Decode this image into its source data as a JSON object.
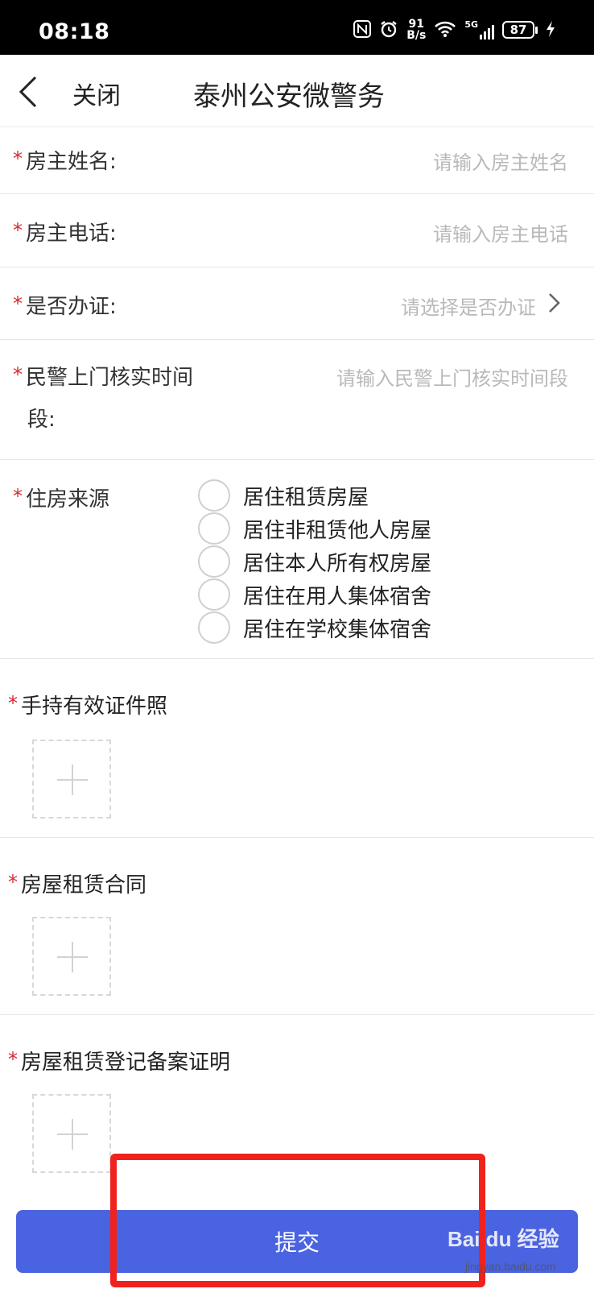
{
  "status_bar": {
    "time": "08:18",
    "net_speed_value": "91",
    "net_speed_unit": "B/s",
    "signal": "5G",
    "battery": "87"
  },
  "nav": {
    "close_label": "关闭",
    "title": "泰州公安微警务"
  },
  "form": {
    "required_mark": "*",
    "owner_name": {
      "label": "房主姓名:",
      "placeholder": "请输入房主姓名"
    },
    "owner_phone": {
      "label": "房主电话:",
      "placeholder": "请输入房主电话"
    },
    "certified": {
      "label": "是否办证:",
      "placeholder": "请选择是否办证"
    },
    "visit_time": {
      "label_line1": "民警上门核实时间",
      "label_line2": "段:",
      "placeholder": "请输入民警上门核实时间段"
    },
    "housing_source": {
      "label": "住房来源",
      "options": [
        "居住租赁房屋",
        "居住非租赁他人房屋",
        "居住本人所有权房屋",
        "居住在用人集体宿舍",
        "居住在学校集体宿舍"
      ]
    },
    "uploads": [
      {
        "label": "手持有效证件照"
      },
      {
        "label": "房屋租赁合同"
      },
      {
        "label": "房屋租赁登记备案证明"
      }
    ]
  },
  "submit_label": "提交",
  "watermark": {
    "logo": "Bai du 经验",
    "url": "jingyan.baidu.com"
  },
  "colors": {
    "accent": "#4a63e0",
    "required": "#d9282f",
    "highlight": "#f0221d"
  }
}
